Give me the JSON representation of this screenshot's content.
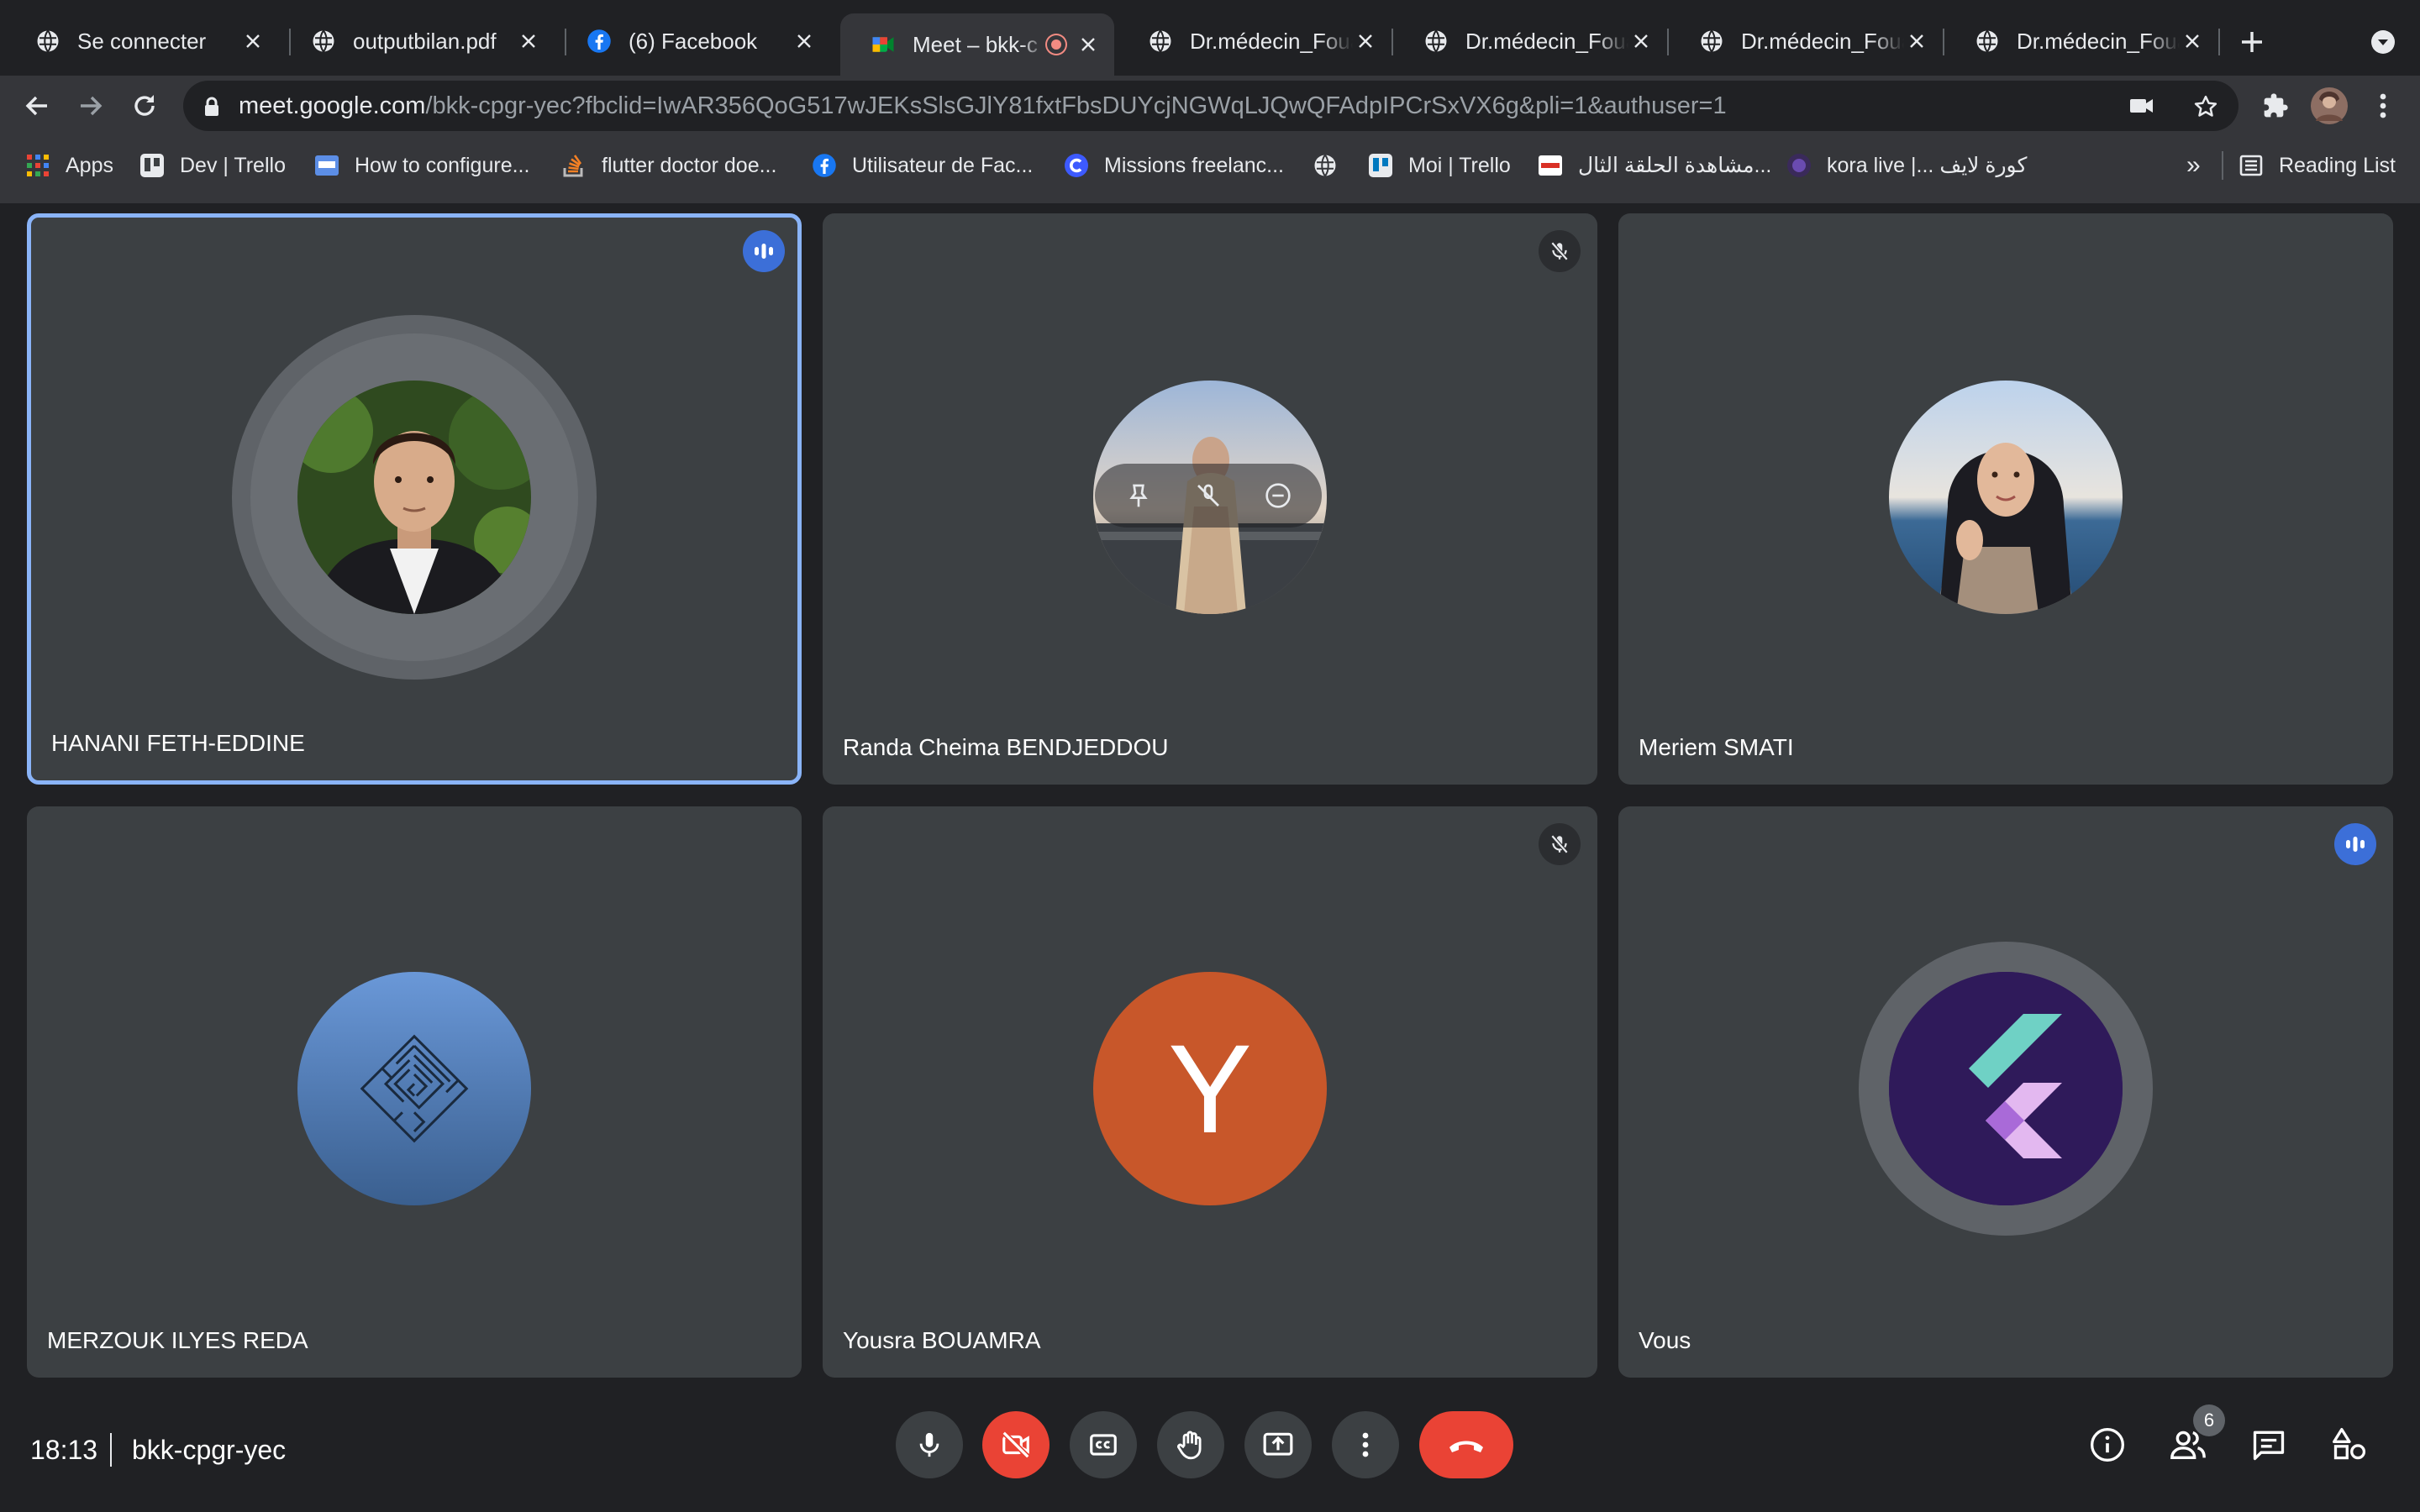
{
  "browser": {
    "tabs": [
      {
        "title": "Se connecter",
        "favicon": "globe-icon"
      },
      {
        "title": "outputbilan.pdf",
        "favicon": "globe-icon"
      },
      {
        "title": "(6) Facebook",
        "favicon": "facebook-icon"
      },
      {
        "title": "Meet – bkk-c",
        "favicon": "google-meet-icon",
        "active": true,
        "recording": true
      },
      {
        "title": "Dr.médecin_Foua",
        "favicon": "globe-icon"
      },
      {
        "title": "Dr.médecin_Foua",
        "favicon": "globe-icon"
      },
      {
        "title": "Dr.médecin_Foua",
        "favicon": "globe-icon"
      },
      {
        "title": "Dr.médecin_Foua",
        "favicon": "globe-icon"
      }
    ],
    "new_tab_icon": "plus-icon",
    "url_host": "meet.google.com",
    "url_rest": "/bkk-cpgr-yec?fbclid=IwAR356QoG517wJEKsSlsGJlY81fxtFbsDUYcjNGWqLJQwQFAdpIPCrSxVX6g&pli=1&authuser=1",
    "bookmarks": [
      {
        "label": "Apps",
        "icon": "apps-grid-icon"
      },
      {
        "label": "Dev | Trello",
        "icon": "trello-icon"
      },
      {
        "label": "How to configure...",
        "icon": "site-icon"
      },
      {
        "label": "flutter doctor doe...",
        "icon": "stackoverflow-icon"
      },
      {
        "label": "Utilisateur de Fac...",
        "icon": "facebook-icon"
      },
      {
        "label": "Missions freelanc...",
        "icon": "codeur-icon"
      },
      {
        "label": "",
        "icon": "globe-icon"
      },
      {
        "label": "Moi | Trello",
        "icon": "trello-icon"
      },
      {
        "label": "مشاهدة الحلقة الثال...",
        "icon": "site-icon"
      },
      {
        "label": "kora live |... كورة لايف",
        "icon": "kora-icon"
      }
    ],
    "more_bookmarks": "»",
    "reading_list": "Reading List"
  },
  "meet": {
    "participants": [
      {
        "name": "HANANI FETH-EDDINE",
        "status": "speaking",
        "avatar": "photo-man"
      },
      {
        "name": "Randa Cheima BENDJEDDOU",
        "status": "muted",
        "avatar": "photo-woman-back"
      },
      {
        "name": "Meriem SMATI",
        "status": "none",
        "avatar": "photo-woman-hijab"
      },
      {
        "name": "MERZOUK ILYES REDA",
        "status": "none",
        "avatar": "maze-icon"
      },
      {
        "name": "Yousra BOUAMRA",
        "status": "muted",
        "avatar_letter": "Y",
        "avatar_color": "#c8572a"
      },
      {
        "name": "Vous",
        "status": "speaking",
        "avatar": "flutter-logo"
      }
    ],
    "time": "18:13",
    "meeting_code": "bkk-cpgr-yec",
    "people_count": "6"
  },
  "colors": {
    "accent": "#8ab4f8",
    "speaking_badge": "#3c6fd8",
    "end_call": "#ea4335",
    "tile_bg": "#3c4043"
  }
}
